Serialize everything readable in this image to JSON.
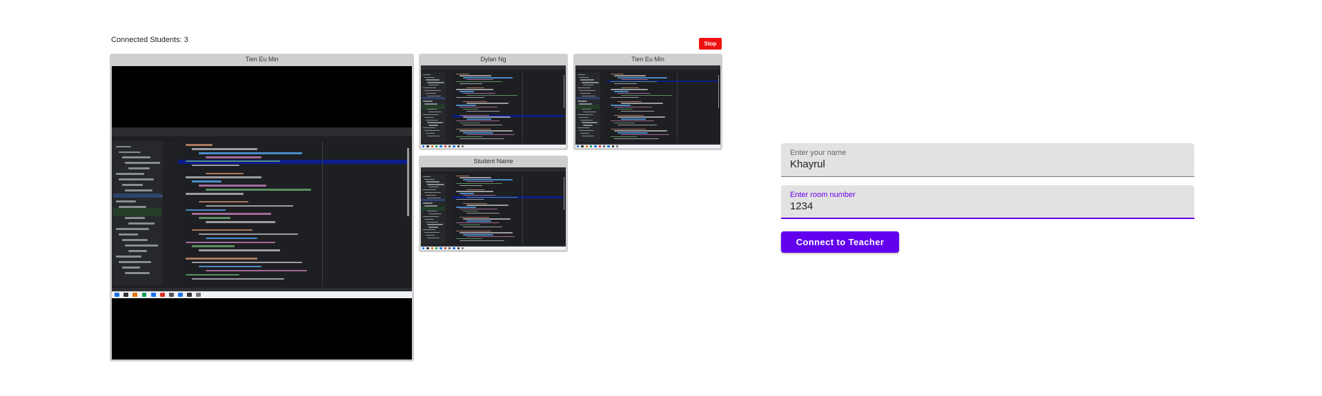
{
  "teacher": {
    "connected_label": "Connected Students: 3",
    "stop_label": "Stop"
  },
  "students": [
    {
      "name": "Tien Eu Min"
    },
    {
      "name": "Dylan Ng"
    },
    {
      "name": "Tien Eu Min"
    },
    {
      "name": "Student Name"
    }
  ],
  "form": {
    "name_label": "Enter your name",
    "name_value": "Khayrul",
    "room_label": "Enter room number",
    "room_value": "1234",
    "connect_label": "Connect to Teacher"
  },
  "colors": {
    "stop": "#ee1111",
    "accent": "#6200ee",
    "tile_frame": "#cfcfcf",
    "ide_background": "#1e1f22"
  }
}
